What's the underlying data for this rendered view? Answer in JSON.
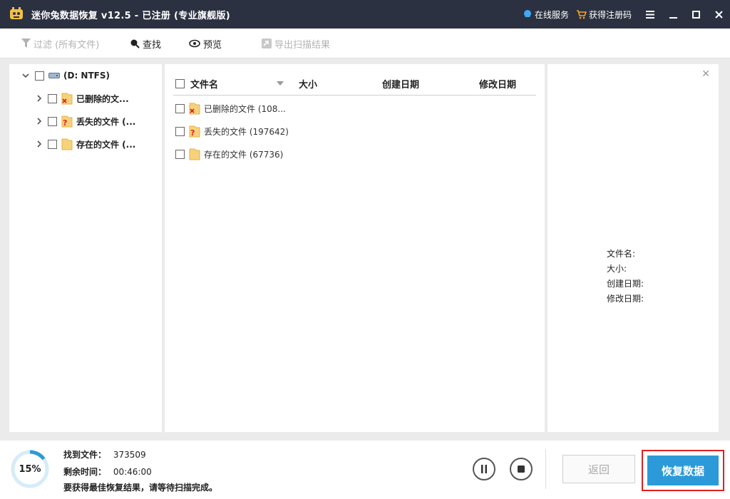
{
  "window": {
    "title": "迷你兔数据恢复 v12.5 - 已注册 (专业旗舰版)",
    "links": {
      "online_service": "在线服务",
      "get_code": "获得注册码"
    }
  },
  "toolbar": {
    "filter": "过滤 (所有文件)",
    "find": "查找",
    "preview": "预览",
    "export": "导出扫描结果"
  },
  "tree": {
    "root": "(D: NTFS)",
    "items": [
      {
        "label": "已删除的文...",
        "icon": "deleted-folder-icon"
      },
      {
        "label": "丢失的文件 (...",
        "icon": "lost-folder-icon"
      },
      {
        "label": "存在的文件 (...",
        "icon": "existing-folder-icon"
      }
    ]
  },
  "list": {
    "headers": {
      "name": "文件名",
      "size": "大小",
      "created": "创建日期",
      "modified": "修改日期"
    },
    "rows": [
      {
        "label": "已删除的文件 (108...",
        "icon": "deleted-folder-icon"
      },
      {
        "label": "丢失的文件 (197642)",
        "icon": "lost-folder-icon"
      },
      {
        "label": "存在的文件 (67736)",
        "icon": "existing-folder-icon"
      }
    ]
  },
  "preview": {
    "props": {
      "name": "文件名:",
      "size": "大小:",
      "created": "创建日期:",
      "modified": "修改日期:"
    }
  },
  "footer": {
    "progress": 15,
    "progress_text": "15%",
    "found_label": "找到文件：",
    "found_value": "373509",
    "remaining_label": "剩余时间：",
    "remaining_value": "00:46:00",
    "tip": "要获得最佳恢复结果，请等待扫描完成。",
    "back": "返回",
    "recover": "恢复数据"
  },
  "colors": {
    "titlebar": "#2b3140",
    "accent": "#2c9ad8",
    "highlight_border": "#e02020",
    "progress_track": "#d6ecf7"
  }
}
